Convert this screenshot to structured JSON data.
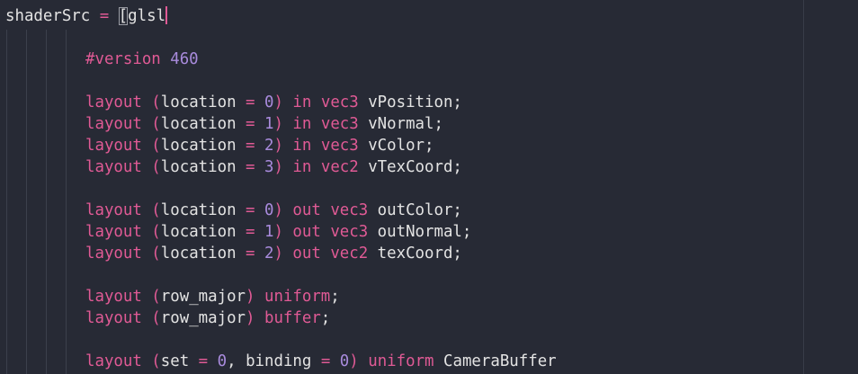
{
  "editor": {
    "language": "glsl",
    "colors": {
      "background": "#272a35",
      "default": "#e3e3e3",
      "keyword": "#e05a95",
      "type": "#e05a95",
      "number": "#a98bdd",
      "directive": "#e05a95",
      "punctuation": "#e05a95",
      "cursor": "#e05a95",
      "guide": "#3c404c"
    },
    "lines": [
      [
        {
          "t": "shaderSrc ",
          "c": "default"
        },
        {
          "t": "=",
          "c": "punctuation"
        },
        {
          "t": " ",
          "c": "default"
        },
        {
          "t": "[",
          "c": "default",
          "cursor_box": true
        },
        {
          "t": "glsl",
          "c": "default"
        }
      ],
      [],
      [
        {
          "t": "#version ",
          "c": "directive"
        },
        {
          "t": "460",
          "c": "number"
        }
      ],
      [],
      [
        {
          "t": "layout ",
          "c": "keyword"
        },
        {
          "t": "(",
          "c": "punctuation"
        },
        {
          "t": "location ",
          "c": "default"
        },
        {
          "t": "=",
          "c": "punctuation"
        },
        {
          "t": " ",
          "c": "default"
        },
        {
          "t": "0",
          "c": "number"
        },
        {
          "t": ")",
          "c": "punctuation"
        },
        {
          "t": " in ",
          "c": "keyword"
        },
        {
          "t": "vec3",
          "c": "type"
        },
        {
          "t": " vPosition;",
          "c": "default"
        }
      ],
      [
        {
          "t": "layout ",
          "c": "keyword"
        },
        {
          "t": "(",
          "c": "punctuation"
        },
        {
          "t": "location ",
          "c": "default"
        },
        {
          "t": "=",
          "c": "punctuation"
        },
        {
          "t": " ",
          "c": "default"
        },
        {
          "t": "1",
          "c": "number"
        },
        {
          "t": ")",
          "c": "punctuation"
        },
        {
          "t": " in ",
          "c": "keyword"
        },
        {
          "t": "vec3",
          "c": "type"
        },
        {
          "t": " vNormal;",
          "c": "default"
        }
      ],
      [
        {
          "t": "layout ",
          "c": "keyword"
        },
        {
          "t": "(",
          "c": "punctuation"
        },
        {
          "t": "location ",
          "c": "default"
        },
        {
          "t": "=",
          "c": "punctuation"
        },
        {
          "t": " ",
          "c": "default"
        },
        {
          "t": "2",
          "c": "number"
        },
        {
          "t": ")",
          "c": "punctuation"
        },
        {
          "t": " in ",
          "c": "keyword"
        },
        {
          "t": "vec3",
          "c": "type"
        },
        {
          "t": " vColor;",
          "c": "default"
        }
      ],
      [
        {
          "t": "layout ",
          "c": "keyword"
        },
        {
          "t": "(",
          "c": "punctuation"
        },
        {
          "t": "location ",
          "c": "default"
        },
        {
          "t": "=",
          "c": "punctuation"
        },
        {
          "t": " ",
          "c": "default"
        },
        {
          "t": "3",
          "c": "number"
        },
        {
          "t": ")",
          "c": "punctuation"
        },
        {
          "t": " in ",
          "c": "keyword"
        },
        {
          "t": "vec2",
          "c": "type"
        },
        {
          "t": " vTexCoord;",
          "c": "default"
        }
      ],
      [],
      [
        {
          "t": "layout ",
          "c": "keyword"
        },
        {
          "t": "(",
          "c": "punctuation"
        },
        {
          "t": "location ",
          "c": "default"
        },
        {
          "t": "=",
          "c": "punctuation"
        },
        {
          "t": " ",
          "c": "default"
        },
        {
          "t": "0",
          "c": "number"
        },
        {
          "t": ")",
          "c": "punctuation"
        },
        {
          "t": " out ",
          "c": "keyword"
        },
        {
          "t": "vec3",
          "c": "type"
        },
        {
          "t": " outColor;",
          "c": "default"
        }
      ],
      [
        {
          "t": "layout ",
          "c": "keyword"
        },
        {
          "t": "(",
          "c": "punctuation"
        },
        {
          "t": "location ",
          "c": "default"
        },
        {
          "t": "=",
          "c": "punctuation"
        },
        {
          "t": " ",
          "c": "default"
        },
        {
          "t": "1",
          "c": "number"
        },
        {
          "t": ")",
          "c": "punctuation"
        },
        {
          "t": " out ",
          "c": "keyword"
        },
        {
          "t": "vec3",
          "c": "type"
        },
        {
          "t": " outNormal;",
          "c": "default"
        }
      ],
      [
        {
          "t": "layout ",
          "c": "keyword"
        },
        {
          "t": "(",
          "c": "punctuation"
        },
        {
          "t": "location ",
          "c": "default"
        },
        {
          "t": "=",
          "c": "punctuation"
        },
        {
          "t": " ",
          "c": "default"
        },
        {
          "t": "2",
          "c": "number"
        },
        {
          "t": ")",
          "c": "punctuation"
        },
        {
          "t": " out ",
          "c": "keyword"
        },
        {
          "t": "vec2",
          "c": "type"
        },
        {
          "t": " texCoord;",
          "c": "default"
        }
      ],
      [],
      [
        {
          "t": "layout ",
          "c": "keyword"
        },
        {
          "t": "(",
          "c": "punctuation"
        },
        {
          "t": "row_major",
          "c": "default"
        },
        {
          "t": ")",
          "c": "punctuation"
        },
        {
          "t": " uniform",
          "c": "keyword"
        },
        {
          "t": ";",
          "c": "default"
        }
      ],
      [
        {
          "t": "layout ",
          "c": "keyword"
        },
        {
          "t": "(",
          "c": "punctuation"
        },
        {
          "t": "row_major",
          "c": "default"
        },
        {
          "t": ")",
          "c": "punctuation"
        },
        {
          "t": " buffer",
          "c": "keyword"
        },
        {
          "t": ";",
          "c": "default"
        }
      ],
      [],
      [
        {
          "t": "layout ",
          "c": "keyword"
        },
        {
          "t": "(",
          "c": "punctuation"
        },
        {
          "t": "set ",
          "c": "default"
        },
        {
          "t": "=",
          "c": "punctuation"
        },
        {
          "t": " ",
          "c": "default"
        },
        {
          "t": "0",
          "c": "number"
        },
        {
          "t": ", binding ",
          "c": "default"
        },
        {
          "t": "=",
          "c": "punctuation"
        },
        {
          "t": " ",
          "c": "default"
        },
        {
          "t": "0",
          "c": "number"
        },
        {
          "t": ")",
          "c": "punctuation"
        },
        {
          "t": " uniform ",
          "c": "keyword"
        },
        {
          "t": "CameraBuffer",
          "c": "default"
        }
      ]
    ]
  }
}
